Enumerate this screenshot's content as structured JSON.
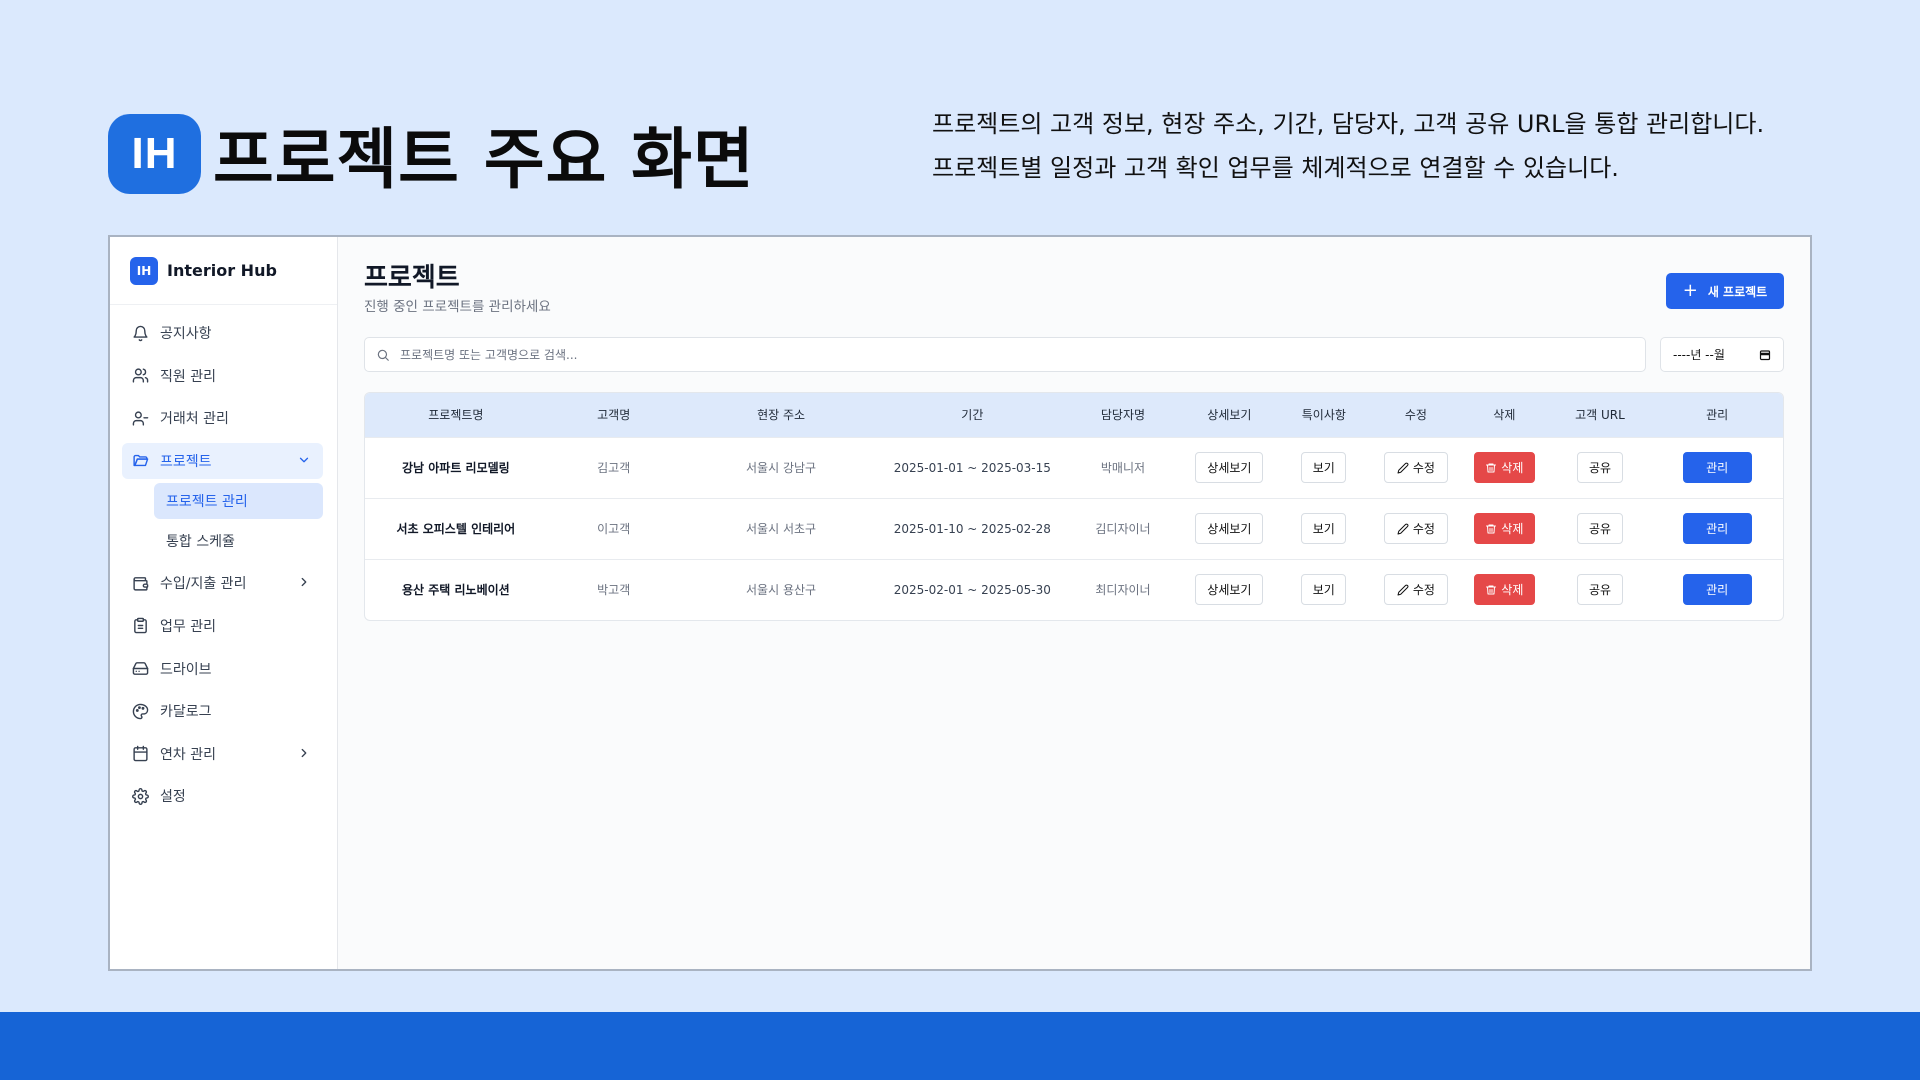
{
  "slide": {
    "logo_text": "IH",
    "title": "프로젝트 주요 화면",
    "desc_line1": "프로젝트의 고객 정보, 현장 주소, 기간, 담당자, 고객 공유 URL을 통합 관리합니다.",
    "desc_line2": "프로젝트별 일정과 고객 확인 업무를 체계적으로 연결할 수 있습니다."
  },
  "app": {
    "brand_logo": "IH",
    "brand_name": "Interior Hub"
  },
  "sidebar": {
    "items": [
      {
        "label": "공지사항",
        "icon": "bell-icon"
      },
      {
        "label": "직원 관리",
        "icon": "users-icon"
      },
      {
        "label": "거래처 관리",
        "icon": "user-group-icon"
      },
      {
        "label": "프로젝트",
        "icon": "folder-icon"
      },
      {
        "label": "수입/지출 관리",
        "icon": "wallet-icon"
      },
      {
        "label": "업무 관리",
        "icon": "clipboard-icon"
      },
      {
        "label": "드라이브",
        "icon": "hard-drive-icon"
      },
      {
        "label": "카달로그",
        "icon": "palette-icon"
      },
      {
        "label": "연차 관리",
        "icon": "calendar-icon"
      },
      {
        "label": "설정",
        "icon": "gear-icon"
      }
    ],
    "sub_items": [
      {
        "label": "프로젝트 관리"
      },
      {
        "label": "통합 스케쥴"
      }
    ]
  },
  "main": {
    "title": "프로젝트",
    "subtitle": "진행 중인 프로젝트를 관리하세요",
    "new_button": "새 프로젝트",
    "search_placeholder": "프로젝트명 또는 고객명으로 검색...",
    "month_value": "----년 --월"
  },
  "table": {
    "headers": [
      "프로젝트명",
      "고객명",
      "현장 주소",
      "기간",
      "담당자명",
      "상세보기",
      "특이사항",
      "수정",
      "삭제",
      "고객 URL",
      "관리"
    ],
    "rows": [
      {
        "name": "강남 아파트 리모델링",
        "client": "김고객",
        "address": "서울시 강남구",
        "period": "2025-01-01 ~ 2025-03-15",
        "manager": "박매니저"
      },
      {
        "name": "서초 오피스텔 인테리어",
        "client": "이고객",
        "address": "서울시 서초구",
        "period": "2025-01-10 ~ 2025-02-28",
        "manager": "김디자이너"
      },
      {
        "name": "용산 주택 리노베이션",
        "client": "박고객",
        "address": "서울시 용산구",
        "period": "2025-02-01 ~ 2025-05-30",
        "manager": "최디자이너"
      }
    ],
    "actions": {
      "detail": "상세보기",
      "view": "보기",
      "edit": "수정",
      "delete": "삭제",
      "share": "공유",
      "manage": "관리"
    }
  },
  "colors": {
    "accent": "#2563eb",
    "danger": "#e54848",
    "slide_bg": "#dbe9fd",
    "band": "#1664d6"
  }
}
